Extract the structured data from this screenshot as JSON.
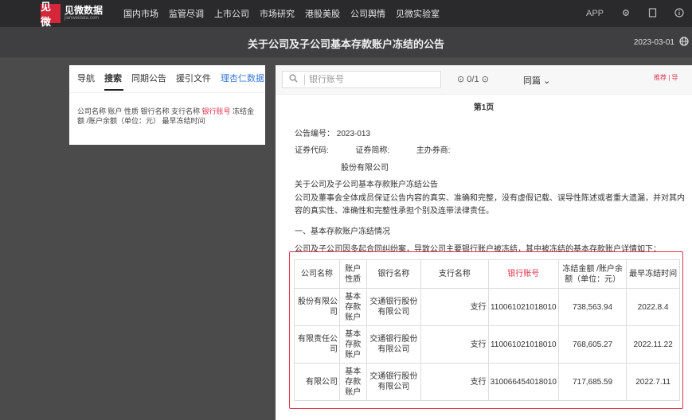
{
  "topnav": {
    "logo_icon": "见微",
    "logo_title": "见微数据",
    "logo_sub": "jianweidata.com",
    "items": [
      "国内市场",
      "监管尽调",
      "上市公司",
      "市场研究",
      "港股美股",
      "公司舆情",
      "见微实验室"
    ],
    "right": {
      "app": "APP",
      "icons": [
        "settings-icon",
        "document-icon",
        "info-icon"
      ]
    }
  },
  "titlebar": {
    "title": "关于公司及子公司基本存款账户冻结的公告",
    "date": "2023-03-01"
  },
  "left_panel": {
    "tabs": [
      "导航",
      "搜索",
      "同期公告",
      "援引文件",
      "理杏仁数据"
    ],
    "active_tab": "搜索",
    "fields_before": "公司名称 账户 性质 银行名称 支行名称 ",
    "fields_highlight": "银行账号",
    "fields_after": " 冻结金额 /账户余额（单位：元） 最早冻结时间"
  },
  "doc_toolbar": {
    "search_placeholder": "银行账号",
    "matches": "0/1",
    "scope": "同篇",
    "share_label": "推荐 | 导"
  },
  "document": {
    "page_label": "第1页",
    "notice_no": "公告编号： 2023-013",
    "securities_line": {
      "code": "证券代码:",
      "abbr": "证券简称:",
      "underwriter": "主办券商:"
    },
    "company": "股份有限公司",
    "heading": "关于公司及子公司基本存款账户冻结公告",
    "statement": "公司及董事会全体成员保证公告内容的真实、准确和完整，没有虚假记载、误导性陈述或者重大遗漏，并对其内容的真实性、准确性和完整性承担个别及连带法律责任。",
    "section1": "一、基本存款账户冻结情况",
    "section1_text": "公司及子公司因多起合同纠纷案，导致公司主要银行账户被冻结，其中被冻结的基本存款账户详情如下："
  },
  "table": {
    "headers": [
      "公司名称",
      "账户性质",
      "银行名称",
      "支行名称",
      "银行账号",
      "冻结金额 /账户余额（单位：元）",
      "最早冻结时间"
    ],
    "rows": [
      [
        "股份有限公司",
        "基本存款账户",
        "交通银行股份有限公司",
        "支行",
        "110061021018010",
        "738,563.94",
        "2022.8.4"
      ],
      [
        "有限责任公司",
        "基本存款账户",
        "交通银行股份有限公司",
        "支行",
        "110061021018010",
        "768,605.27",
        "2022.11.22"
      ],
      [
        "有限公司",
        "基本存款账户",
        "交通银行股份有限公司",
        "支行",
        "310066454018010",
        "717,685.59",
        "2022.7.11"
      ]
    ]
  },
  "colors": {
    "brand": "#d6263a",
    "highlight": "#e0334d",
    "link": "#3a78d8",
    "topbar": "#2a2a2c"
  }
}
